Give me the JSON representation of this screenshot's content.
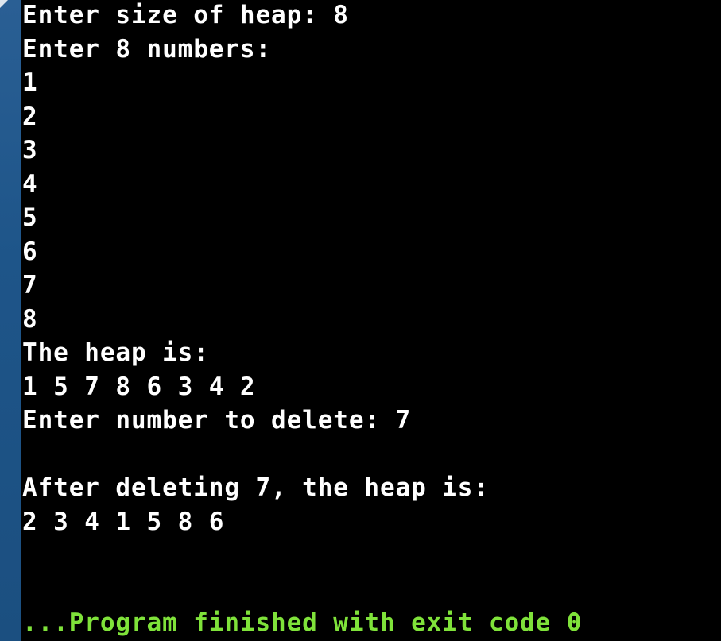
{
  "terminal": {
    "lines": [
      "Enter size of heap: 8",
      "Enter 8 numbers:",
      "1",
      "2",
      "3",
      "4",
      "5",
      "6",
      "7",
      "8",
      "The heap is:",
      "1 5 7 8 6 3 4 2",
      "Enter number to delete: 7",
      "",
      "After deleting 7, the heap is:",
      "2 3 4 1 5 8 6",
      "",
      "",
      "...Program finished with exit code 0"
    ]
  },
  "colors": {
    "background": "#000000",
    "text": "#ffffff",
    "status": "#7fe23a",
    "side_bar": "#1e5589"
  }
}
